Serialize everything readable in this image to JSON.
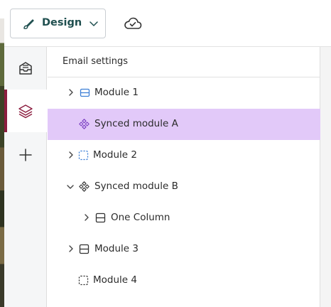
{
  "toolbar": {
    "design_label": "Design",
    "icons": [
      "paintbrush-icon",
      "chevron-down-icon",
      "cloud-check-icon"
    ]
  },
  "rail": {
    "items": [
      {
        "icon": "inbox-icon",
        "active": false
      },
      {
        "icon": "layers-icon",
        "active": true
      },
      {
        "icon": "plus-icon",
        "active": false
      }
    ],
    "accent_color": "#8c1d3f"
  },
  "panel": {
    "title": "Email settings",
    "rows": [
      {
        "label": "Module 1",
        "icon": "module-row-icon",
        "expandable": true,
        "expanded": false,
        "selected": false,
        "depth": 1
      },
      {
        "label": "Synced module A",
        "icon": "synced-module-icon",
        "expandable": false,
        "expanded": false,
        "selected": true,
        "depth": 1
      },
      {
        "label": "Module 2",
        "icon": "empty-module-icon",
        "expandable": true,
        "expanded": false,
        "selected": false,
        "depth": 1
      },
      {
        "label": "Synced module B",
        "icon": "synced-module-icon",
        "expandable": true,
        "expanded": true,
        "selected": false,
        "depth": 1
      },
      {
        "label": "One Column",
        "icon": "column-layout-icon",
        "expandable": true,
        "expanded": false,
        "selected": false,
        "depth": 2
      },
      {
        "label": "Module 3",
        "icon": "column-layout-icon",
        "expandable": true,
        "expanded": false,
        "selected": false,
        "depth": 1
      },
      {
        "label": "Module 4",
        "icon": "empty-module-icon",
        "expandable": false,
        "expanded": false,
        "selected": false,
        "depth": 1
      }
    ],
    "selected_color": "#e2c9f9"
  }
}
